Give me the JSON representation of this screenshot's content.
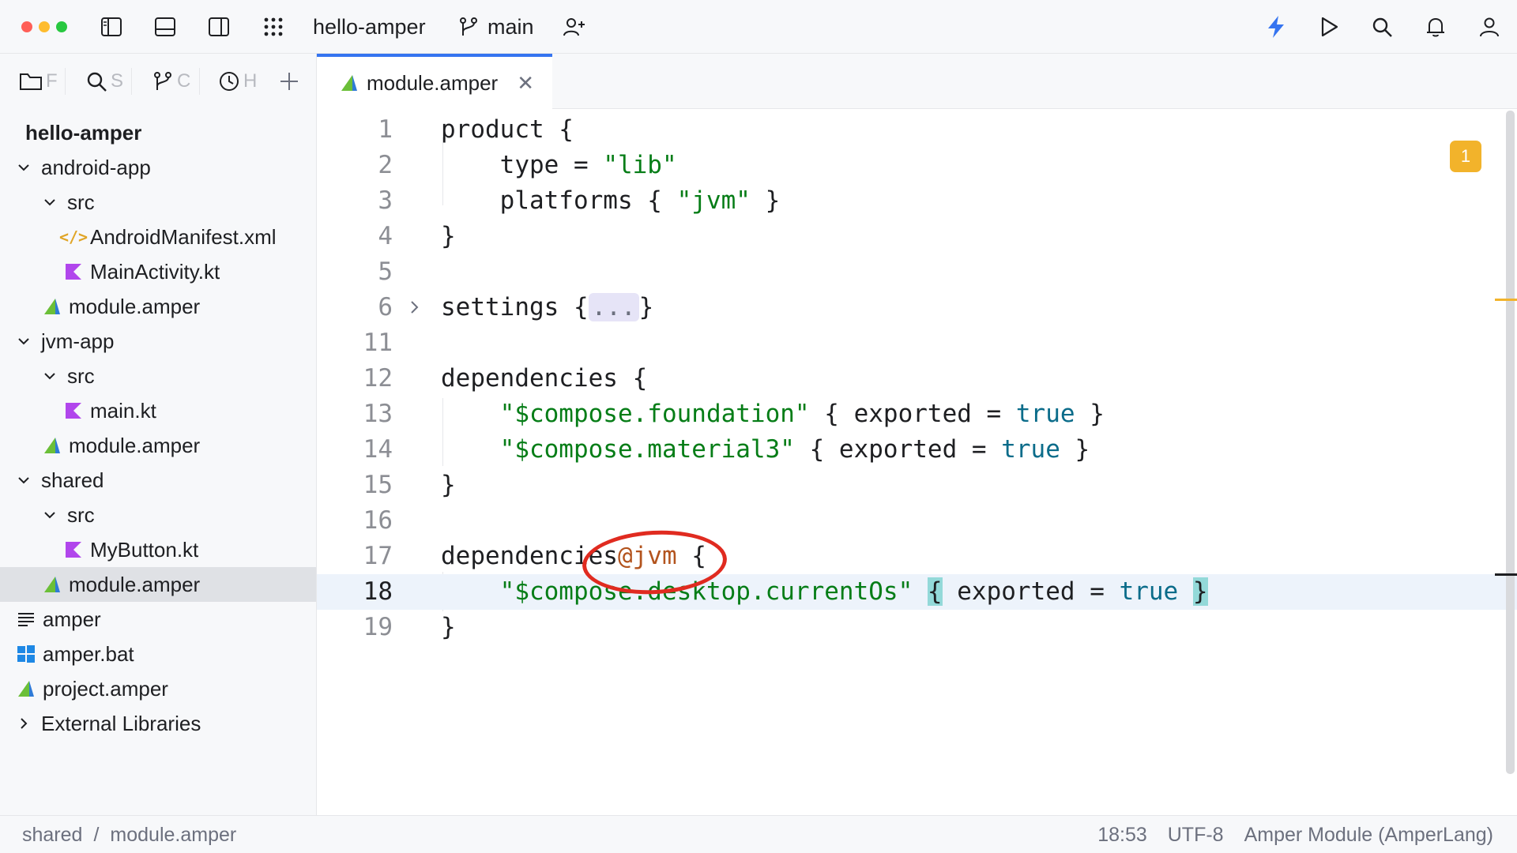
{
  "topbar": {
    "project_name": "hello-amper",
    "branch": "main"
  },
  "sidebar": {
    "tabs": [
      {
        "label": "F"
      },
      {
        "label": "S"
      },
      {
        "label": "C"
      },
      {
        "label": "H"
      }
    ],
    "tree": [
      {
        "label": "hello-amper",
        "type": "root"
      },
      {
        "label": "android-app",
        "type": "folder"
      },
      {
        "label": "src",
        "type": "folder"
      },
      {
        "label": "AndroidManifest.xml",
        "type": "xml"
      },
      {
        "label": "MainActivity.kt",
        "type": "kotlin"
      },
      {
        "label": "module.amper",
        "type": "amper"
      },
      {
        "label": "jvm-app",
        "type": "folder"
      },
      {
        "label": "src",
        "type": "folder"
      },
      {
        "label": "main.kt",
        "type": "kotlin"
      },
      {
        "label": "module.amper",
        "type": "amper"
      },
      {
        "label": "shared",
        "type": "folder"
      },
      {
        "label": "src",
        "type": "folder"
      },
      {
        "label": "MyButton.kt",
        "type": "kotlin"
      },
      {
        "label": "module.amper",
        "type": "amper"
      },
      {
        "label": "amper",
        "type": "text"
      },
      {
        "label": "amper.bat",
        "type": "windows"
      },
      {
        "label": "project.amper",
        "type": "amper"
      },
      {
        "label": "External Libraries",
        "type": "library"
      }
    ]
  },
  "editor": {
    "tab_label": "module.amper",
    "lines": [
      {
        "num": "1",
        "p1": "product {"
      },
      {
        "num": "2",
        "p1": "type = ",
        "s1": "\"lib\""
      },
      {
        "num": "3",
        "p1": "platforms { ",
        "s1": "\"jvm\"",
        "p2": " }"
      },
      {
        "num": "4",
        "p1": "}"
      },
      {
        "num": "5"
      },
      {
        "num": "6",
        "p1": "settings {",
        "ell": "...",
        "p2": "}"
      },
      {
        "num": "11"
      },
      {
        "num": "12",
        "p1": "dependencies {"
      },
      {
        "num": "13",
        "s1": "\"$compose.foundation\"",
        "p1": " { exported = ",
        "kw": "true",
        "p2": " }"
      },
      {
        "num": "14",
        "s1": "\"$compose.material3\"",
        "p1": " { exported = ",
        "kw": "true",
        "p2": " }"
      },
      {
        "num": "15",
        "p1": "}"
      },
      {
        "num": "16"
      },
      {
        "num": "17",
        "p1": "dependencies",
        "at": "@",
        "jvm": "jvm",
        "p2": " {"
      },
      {
        "num": "18",
        "s1": "\"$compose.desktop.currentOs\"",
        "b1": "{",
        "p1": " exported = ",
        "kw": "true",
        "b2": "}"
      },
      {
        "num": "19",
        "p1": "}"
      }
    ],
    "warning_count": "1"
  },
  "statusbar": {
    "breadcrumb": [
      "shared",
      "/",
      "module.amper"
    ],
    "position": "18:53",
    "encoding": "UTF-8",
    "file_type": "Amper Module (AmperLang)"
  },
  "colors": {
    "accent": "#3574f0",
    "string": "#067d17",
    "keyword": "#0b6c8a",
    "warning": "#f2b32b",
    "annotation": "#e02b20"
  }
}
